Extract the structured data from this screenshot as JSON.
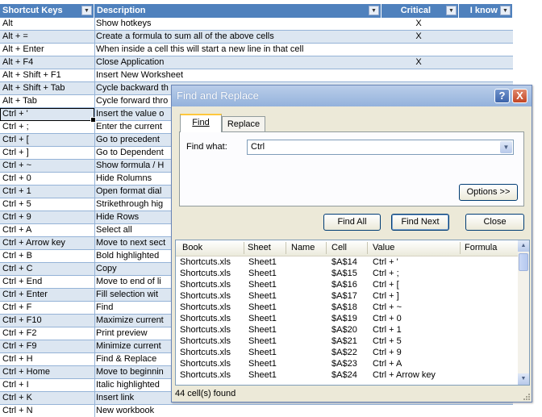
{
  "sheet": {
    "headers": [
      "Shortcut Keys",
      "Description",
      "Critical",
      "I know"
    ],
    "rows": [
      {
        "key": "Alt",
        "desc": "Show hotkeys",
        "critical": "X"
      },
      {
        "key": "Alt + =",
        "desc": "Create a formula to sum all of the above cells",
        "critical": "X"
      },
      {
        "key": "Alt + Enter",
        "desc": "When inside a cell this will start a new line in that cell",
        "critical": ""
      },
      {
        "key": "Alt + F4",
        "desc": "Close Application",
        "critical": "X"
      },
      {
        "key": "Alt + Shift + F1",
        "desc": "Insert New Worksheet",
        "critical": ""
      },
      {
        "key": "Alt + Shift + Tab",
        "desc": "Cycle backward th",
        "critical": ""
      },
      {
        "key": "Alt + Tab",
        "desc": "Cycle forward thro",
        "critical": ""
      },
      {
        "key": "Ctrl + '",
        "desc": "Insert the value o",
        "critical": ""
      },
      {
        "key": "Ctrl + ;",
        "desc": "Enter the current",
        "critical": ""
      },
      {
        "key": "Ctrl + [",
        "desc": "Go to precedent",
        "critical": ""
      },
      {
        "key": "Ctrl + ]",
        "desc": "Go to Dependent",
        "critical": ""
      },
      {
        "key": "Ctrl + ~",
        "desc": "Show formula / H",
        "critical": ""
      },
      {
        "key": "Ctrl + 0",
        "desc": "Hide Rolumns",
        "critical": ""
      },
      {
        "key": "Ctrl + 1",
        "desc": "Open format dial",
        "critical": ""
      },
      {
        "key": "Ctrl + 5",
        "desc": "Strikethrough hig",
        "critical": ""
      },
      {
        "key": "Ctrl + 9",
        "desc": "Hide Rows",
        "critical": ""
      },
      {
        "key": "Ctrl + A",
        "desc": "Select all",
        "critical": ""
      },
      {
        "key": "Ctrl + Arrow key",
        "desc": "Move to next sect",
        "critical": ""
      },
      {
        "key": "Ctrl + B",
        "desc": "Bold highlighted",
        "critical": ""
      },
      {
        "key": "Ctrl + C",
        "desc": "Copy",
        "critical": ""
      },
      {
        "key": "Ctrl + End",
        "desc": "Move to end of li",
        "critical": ""
      },
      {
        "key": "Ctrl + Enter",
        "desc": "Fill selection wit",
        "critical": ""
      },
      {
        "key": "Ctrl + F",
        "desc": "Find",
        "critical": ""
      },
      {
        "key": "Ctrl + F10",
        "desc": "Maximize current",
        "critical": ""
      },
      {
        "key": "Ctrl + F2",
        "desc": "Print preview",
        "critical": ""
      },
      {
        "key": "Ctrl + F9",
        "desc": "Minimize current",
        "critical": ""
      },
      {
        "key": "Ctrl + H",
        "desc": "Find & Replace",
        "critical": ""
      },
      {
        "key": "Ctrl + Home",
        "desc": "Move to beginnin",
        "critical": ""
      },
      {
        "key": "Ctrl + I",
        "desc": "Italic highlighted",
        "critical": ""
      },
      {
        "key": "Ctrl + K",
        "desc": "Insert link",
        "critical": ""
      },
      {
        "key": "Ctrl + N",
        "desc": "New workbook",
        "critical": ""
      }
    ]
  },
  "dialog": {
    "title": "Find and Replace",
    "help_glyph": "?",
    "close_glyph": "X",
    "tabs": [
      "Find",
      "Replace"
    ],
    "find_label": "Find what:",
    "find_value": "Ctrl",
    "options_label": "Options >>",
    "find_all_label": "Find All",
    "find_next_label": "Find Next",
    "close_label": "Close",
    "result_columns": [
      "Book",
      "Sheet",
      "Name",
      "Cell",
      "Value",
      "Formula"
    ],
    "results": [
      {
        "book": "Shortcuts.xls",
        "sheet": "Sheet1",
        "cell": "$A$14",
        "value": "Ctrl + '"
      },
      {
        "book": "Shortcuts.xls",
        "sheet": "Sheet1",
        "cell": "$A$15",
        "value": "Ctrl + ;"
      },
      {
        "book": "Shortcuts.xls",
        "sheet": "Sheet1",
        "cell": "$A$16",
        "value": "Ctrl + ["
      },
      {
        "book": "Shortcuts.xls",
        "sheet": "Sheet1",
        "cell": "$A$17",
        "value": "Ctrl + ]"
      },
      {
        "book": "Shortcuts.xls",
        "sheet": "Sheet1",
        "cell": "$A$18",
        "value": "Ctrl + ~"
      },
      {
        "book": "Shortcuts.xls",
        "sheet": "Sheet1",
        "cell": "$A$19",
        "value": "Ctrl + 0"
      },
      {
        "book": "Shortcuts.xls",
        "sheet": "Sheet1",
        "cell": "$A$20",
        "value": "Ctrl + 1"
      },
      {
        "book": "Shortcuts.xls",
        "sheet": "Sheet1",
        "cell": "$A$21",
        "value": "Ctrl + 5"
      },
      {
        "book": "Shortcuts.xls",
        "sheet": "Sheet1",
        "cell": "$A$22",
        "value": "Ctrl + 9"
      },
      {
        "book": "Shortcuts.xls",
        "sheet": "Sheet1",
        "cell": "$A$23",
        "value": "Ctrl + A"
      },
      {
        "book": "Shortcuts.xls",
        "sheet": "Sheet1",
        "cell": "$A$24",
        "value": "Ctrl + Arrow key"
      }
    ],
    "status": "44 cell(s) found"
  }
}
